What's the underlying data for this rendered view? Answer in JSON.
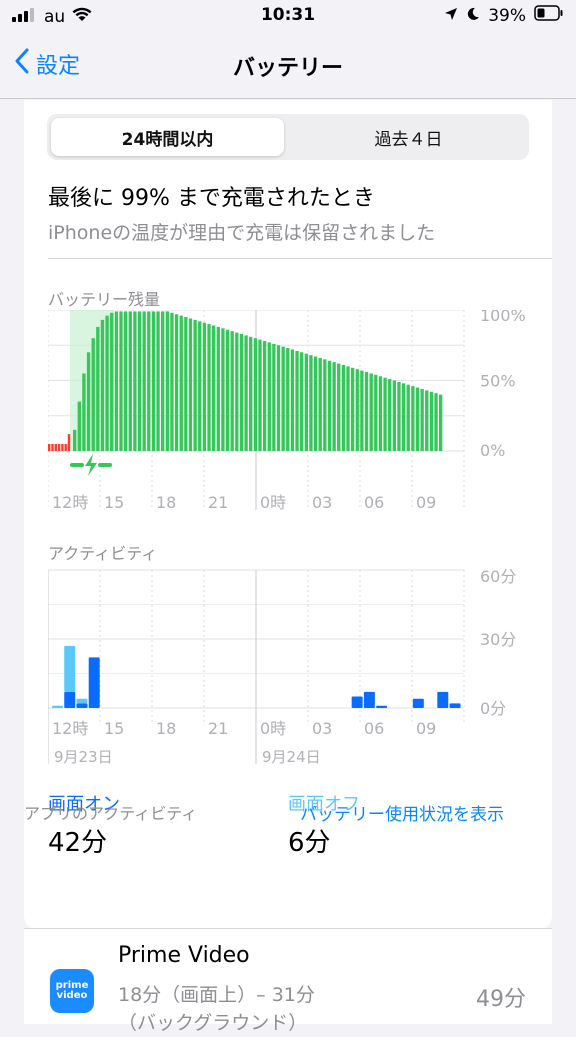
{
  "status_bar": {
    "carrier": "au",
    "time": "10:31",
    "battery_percent": "39%"
  },
  "nav": {
    "back_label": "設定",
    "title": "バッテリー"
  },
  "segments": {
    "selected": "24時間以内",
    "other": "過去４日"
  },
  "last_charge": {
    "title": "最後に 99% まで充電されたとき",
    "subtitle": "iPhoneの温度が理由で充電は保留されました"
  },
  "battery_chart": {
    "label": "バッテリー残量",
    "y_ticks": [
      "100%",
      "50%",
      "0%"
    ]
  },
  "activity_chart": {
    "label": "アクティビティ",
    "y_ticks": [
      "60分",
      "30分",
      "0分"
    ]
  },
  "x_ticks": [
    "12時",
    "15",
    "18",
    "21",
    "0時",
    "03",
    "06",
    "09"
  ],
  "date_labels": [
    "9月23日",
    "9月24日"
  ],
  "screen_on": {
    "label": "画面オン",
    "value": "42分"
  },
  "screen_off": {
    "label": "画面オフ",
    "value": "6分"
  },
  "app_activity": {
    "label": "アプリのアクティビティ",
    "link": "バッテリー使用状況を表示"
  },
  "apps": [
    {
      "icon_line1": "prime",
      "icon_line2": "video",
      "name": "Prime Video",
      "detail_line1": "18分（画面上）– 31分",
      "detail_line2": "（バックグラウンド）",
      "percent": "49分"
    }
  ],
  "colors": {
    "accent": "#0a84ff",
    "battery_green": "#35c759",
    "charge_low": "#ff3b30",
    "activity_dark": "#0a6cff",
    "activity_light": "#5ac8fa"
  },
  "chart_data": [
    {
      "type": "bar",
      "title": "バッテリー残量",
      "x_ticks": [
        "12時",
        "15",
        "18",
        "21",
        "0時",
        "03",
        "06",
        "09"
      ],
      "ylim": [
        0,
        100
      ],
      "y_ticks": [
        "0%",
        "50%",
        "100%"
      ],
      "series": [
        {
          "values_red": [
            5,
            5,
            5,
            5,
            5,
            5,
            12
          ],
          "values": [
            15,
            35,
            55,
            70,
            80,
            88,
            93,
            96,
            98,
            99,
            99,
            99,
            99,
            99,
            99,
            99,
            99,
            99,
            99,
            99,
            99,
            98,
            97,
            96,
            95,
            94,
            93,
            92,
            91,
            90,
            89,
            88,
            87,
            86,
            85,
            84,
            83,
            82,
            81,
            80,
            79,
            78,
            77,
            76,
            75,
            74,
            73,
            72,
            71,
            70,
            69,
            68,
            67,
            66,
            65,
            64,
            63,
            62,
            61,
            60,
            59,
            58,
            57,
            56,
            55,
            54,
            53,
            52,
            51,
            50,
            49,
            48,
            47,
            46,
            45,
            44,
            43,
            42,
            41,
            40
          ]
        }
      ]
    },
    {
      "type": "bar",
      "title": "アクティビティ",
      "ylim": [
        0,
        60
      ],
      "y_ticks": [
        "0分",
        "30分",
        "60分"
      ],
      "x_ticks": [
        "12時",
        "15",
        "18",
        "21",
        "0時",
        "03",
        "06",
        "09"
      ],
      "series": [
        {
          "name": "画面オン",
          "values": [
            0,
            7,
            2,
            22,
            0,
            0,
            0,
            0,
            0,
            0,
            0,
            0,
            0,
            0,
            0,
            0,
            0,
            0,
            0,
            0,
            0,
            0,
            0,
            0,
            5,
            7,
            1,
            0,
            0,
            4,
            0,
            7,
            2,
            0
          ]
        },
        {
          "name": "画面オフ",
          "values": [
            1,
            20,
            2,
            0,
            0,
            0,
            0,
            0,
            0,
            0,
            0,
            0,
            0,
            0,
            0,
            0,
            0,
            0,
            0,
            0,
            0,
            0,
            0,
            0,
            0,
            0,
            0,
            0,
            0,
            0,
            0,
            0,
            0,
            0
          ]
        }
      ]
    }
  ]
}
